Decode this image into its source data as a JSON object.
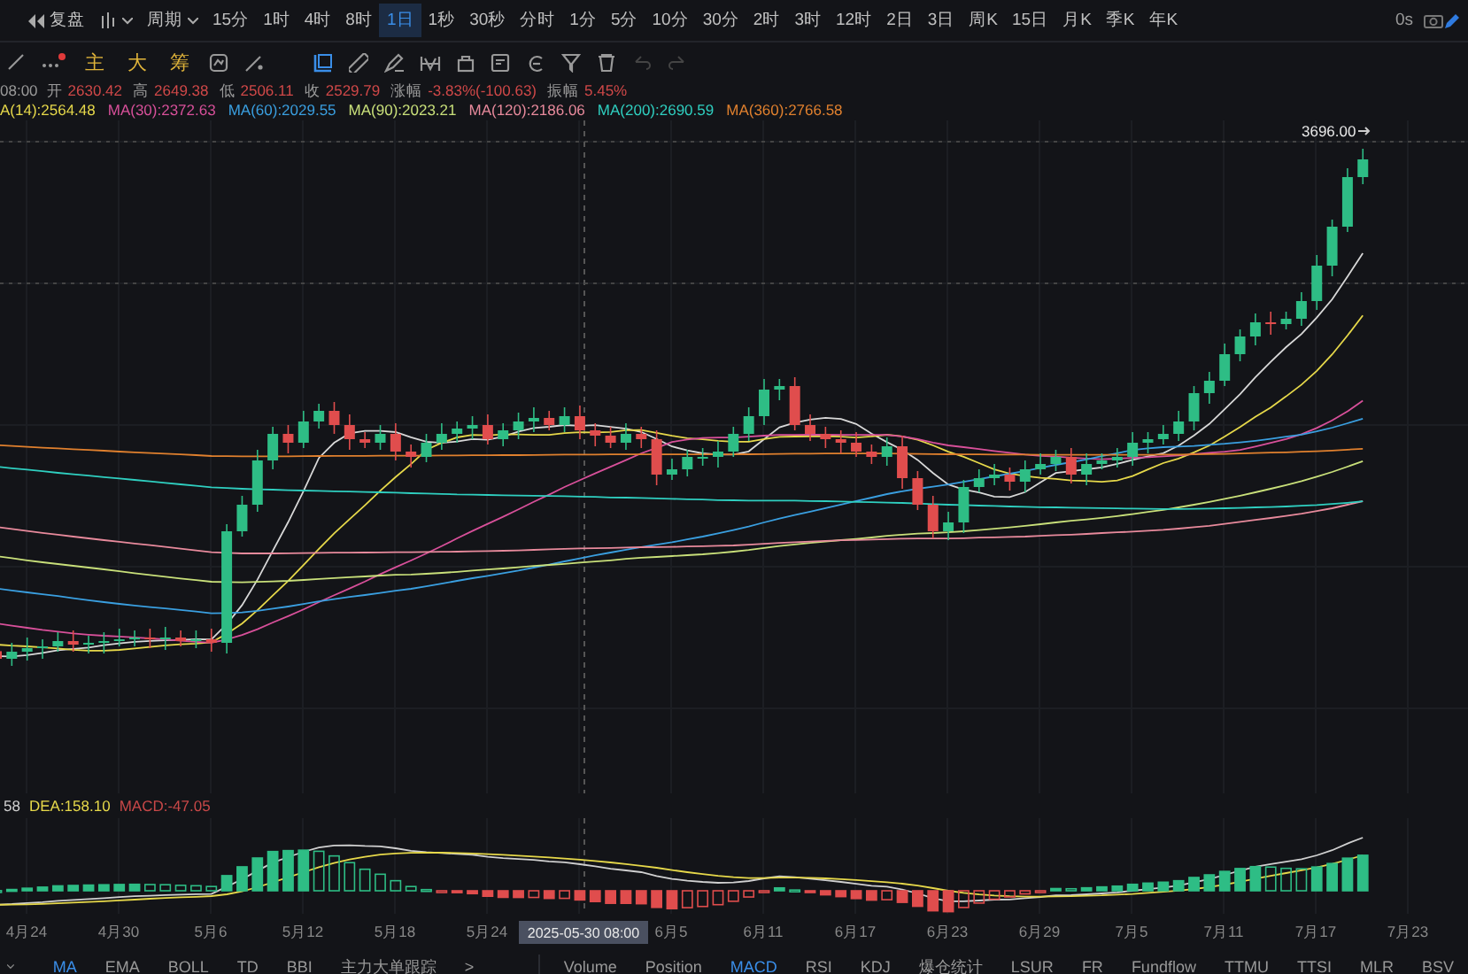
{
  "top_bar": {
    "replay": "复盘",
    "period_menu": "周期",
    "periods": [
      {
        "label": "15分",
        "selected": false
      },
      {
        "label": "1时",
        "selected": false
      },
      {
        "label": "4时",
        "selected": false
      },
      {
        "label": "8时",
        "selected": false
      },
      {
        "label": "1日",
        "selected": true
      },
      {
        "label": "1秒",
        "selected": false
      },
      {
        "label": "30秒",
        "selected": false
      },
      {
        "label": "分时",
        "selected": false
      },
      {
        "label": "1分",
        "selected": false
      },
      {
        "label": "5分",
        "selected": false
      },
      {
        "label": "10分",
        "selected": false
      },
      {
        "label": "30分",
        "selected": false
      },
      {
        "label": "2时",
        "selected": false
      },
      {
        "label": "3时",
        "selected": false
      },
      {
        "label": "12时",
        "selected": false
      },
      {
        "label": "2日",
        "selected": false
      },
      {
        "label": "3日",
        "selected": false
      },
      {
        "label": "周K",
        "selected": false
      },
      {
        "label": "15日",
        "selected": false
      },
      {
        "label": "月K",
        "selected": false
      },
      {
        "label": "季K",
        "selected": false
      },
      {
        "label": "年K",
        "selected": false
      }
    ],
    "refresh": "0s"
  },
  "toolbar": {
    "text_tools": [
      "主",
      "大",
      "筹"
    ]
  },
  "ohlc": {
    "time": "08:00",
    "fields": [
      {
        "label": "开",
        "value": "2630.42"
      },
      {
        "label": "高",
        "value": "2649.38"
      },
      {
        "label": "低",
        "value": "2506.11"
      },
      {
        "label": "收",
        "value": "2529.79"
      },
      {
        "label": "涨幅",
        "value": "-3.83%(-100.63)"
      },
      {
        "label": "振幅",
        "value": "5.45%"
      }
    ]
  },
  "ma_legend": [
    {
      "label": "A(14):2564.48",
      "color": "#e6d84a"
    },
    {
      "label": "MA(30):2372.63",
      "color": "#d8509a"
    },
    {
      "label": "MA(60):2029.55",
      "color": "#3a9fe0"
    },
    {
      "label": "MA(90):2023.21",
      "color": "#c9e07a"
    },
    {
      "label": "MA(120):2186.06",
      "color": "#e88a9c"
    },
    {
      "label": "MA(200):2690.59",
      "color": "#2fcfc0"
    },
    {
      "label": "MA(360):2766.58",
      "color": "#e0802e"
    }
  ],
  "chart": {
    "price_label": "3696.00",
    "crosshair_date": "2025-05-30 08:00",
    "dates": [
      "4月24",
      "4月30",
      "5月6",
      "5月12",
      "5月18",
      "5月24",
      "6月5",
      "6月11",
      "6月17",
      "6月23",
      "6月29",
      "7月5",
      "7月11",
      "7月17",
      "7月23"
    ]
  },
  "macd_legend": [
    {
      "label": "58",
      "color": "#d0d0d0"
    },
    {
      "label": "DEA:158.10",
      "color": "#e6d84a"
    },
    {
      "label": "MACD:-47.05",
      "color": "#c84848"
    }
  ],
  "indicator_bar": {
    "main": [
      {
        "label": "MA",
        "selected": true
      },
      {
        "label": "EMA",
        "selected": false
      },
      {
        "label": "BOLL",
        "selected": false
      },
      {
        "label": "TD",
        "selected": false
      },
      {
        "label": "BBI",
        "selected": false
      },
      {
        "label": "主力大单跟踪",
        "selected": false
      }
    ],
    "more": ">",
    "sub": [
      {
        "label": "Volume",
        "selected": false
      },
      {
        "label": "Position",
        "selected": false
      },
      {
        "label": "MACD",
        "selected": true
      },
      {
        "label": "RSI",
        "selected": false
      },
      {
        "label": "KDJ",
        "selected": false
      },
      {
        "label": "爆仓统计",
        "selected": false
      },
      {
        "label": "LSUR",
        "selected": false
      },
      {
        "label": "FR",
        "selected": false
      },
      {
        "label": "Fundflow",
        "selected": false
      },
      {
        "label": "TTMU",
        "selected": false
      },
      {
        "label": "TTSI",
        "selected": false
      },
      {
        "label": "MLR",
        "selected": false
      },
      {
        "label": "BSV",
        "selected": false
      }
    ]
  }
}
